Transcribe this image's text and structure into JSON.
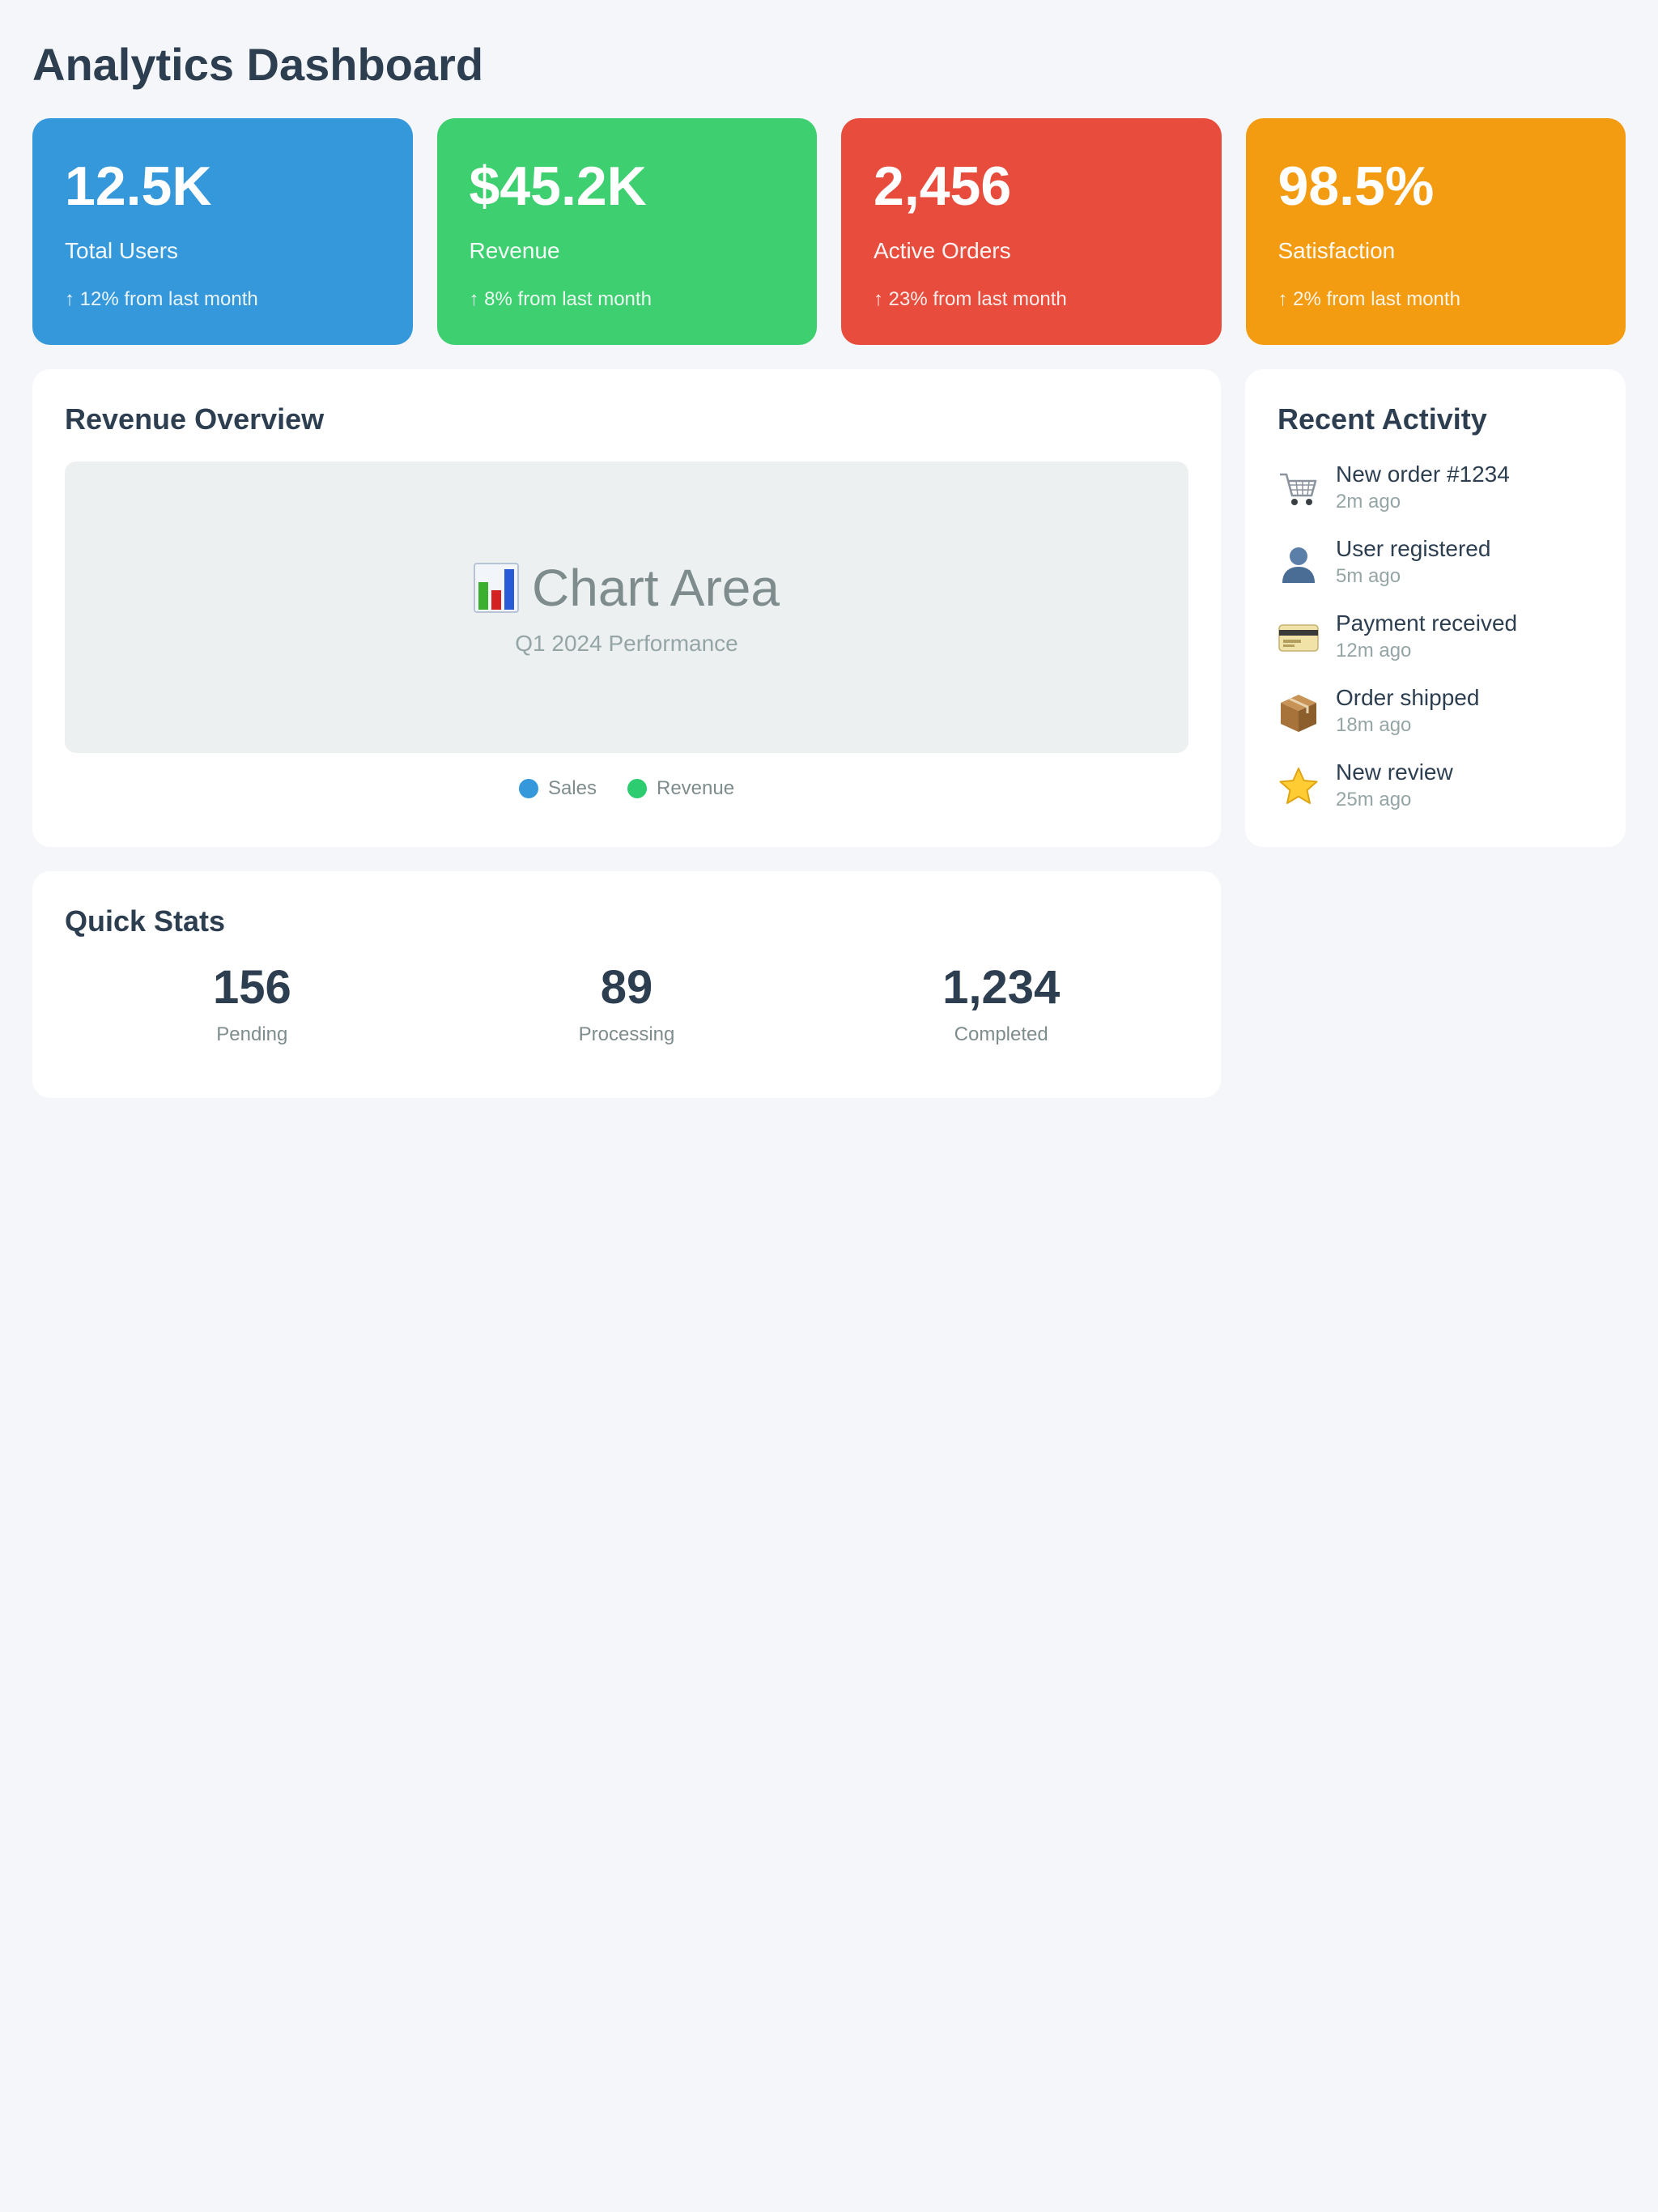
{
  "header": {
    "title": "Analytics Dashboard"
  },
  "stat_cards": [
    {
      "value": "12.5K",
      "label": "Total Users",
      "change": "↑ 12% from last month",
      "color": "#3498db"
    },
    {
      "value": "$45.2K",
      "label": "Revenue",
      "change": "↑ 8% from last month",
      "color": "#3ecf70"
    },
    {
      "value": "2,456",
      "label": "Active Orders",
      "change": "↑ 23% from last month",
      "color": "#e74c3c"
    },
    {
      "value": "98.5%",
      "label": "Satisfaction",
      "change": "↑ 2% from last month",
      "color": "#f39c12"
    }
  ],
  "revenue_overview": {
    "title": "Revenue Overview",
    "chart_placeholder": {
      "icon": "bar-chart-icon",
      "title": "Chart Area",
      "subtitle": "Q1 2024 Performance"
    },
    "legend": [
      {
        "label": "Sales",
        "color": "#3498db"
      },
      {
        "label": "Revenue",
        "color": "#2ecc71"
      }
    ]
  },
  "recent_activity": {
    "title": "Recent Activity",
    "items": [
      {
        "icon": "shopping-cart-icon",
        "title": "New order #1234",
        "time": "2m ago"
      },
      {
        "icon": "user-icon",
        "title": "User registered",
        "time": "5m ago"
      },
      {
        "icon": "credit-card-icon",
        "title": "Payment received",
        "time": "12m ago"
      },
      {
        "icon": "package-icon",
        "title": "Order shipped",
        "time": "18m ago"
      },
      {
        "icon": "star-icon",
        "title": "New review",
        "time": "25m ago"
      }
    ]
  },
  "quick_stats": {
    "title": "Quick Stats",
    "items": [
      {
        "value": "156",
        "label": "Pending"
      },
      {
        "value": "89",
        "label": "Processing"
      },
      {
        "value": "1,234",
        "label": "Completed"
      }
    ]
  }
}
